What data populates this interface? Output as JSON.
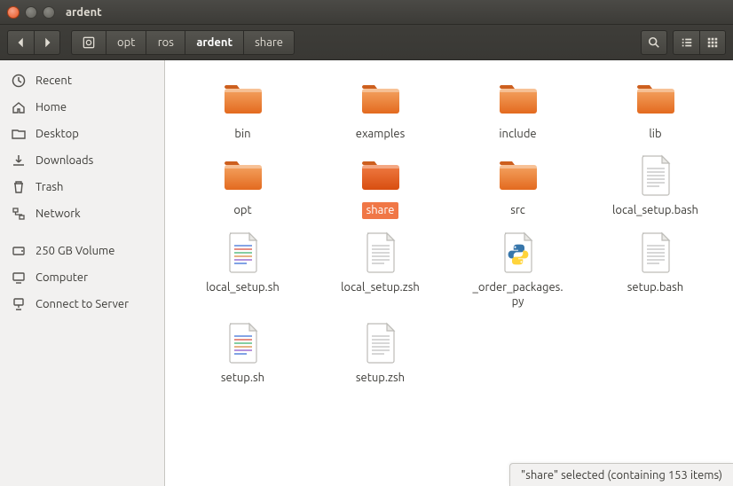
{
  "window": {
    "title": "ardent"
  },
  "toolbar": {
    "breadcrumb": [
      {
        "label": "",
        "icon": "disk"
      },
      {
        "label": "opt"
      },
      {
        "label": "ros"
      },
      {
        "label": "ardent",
        "active": true
      },
      {
        "label": "share"
      }
    ]
  },
  "sidebar": {
    "places": [
      {
        "label": "Recent",
        "icon": "recent"
      },
      {
        "label": "Home",
        "icon": "home"
      },
      {
        "label": "Desktop",
        "icon": "desktop"
      },
      {
        "label": "Downloads",
        "icon": "downloads"
      },
      {
        "label": "Trash",
        "icon": "trash"
      },
      {
        "label": "Network",
        "icon": "network"
      }
    ],
    "devices": [
      {
        "label": "250 GB Volume",
        "icon": "drive"
      },
      {
        "label": "Computer",
        "icon": "computer"
      },
      {
        "label": "Connect to Server",
        "icon": "connect"
      }
    ]
  },
  "files": [
    {
      "name": "bin",
      "type": "folder"
    },
    {
      "name": "examples",
      "type": "folder"
    },
    {
      "name": "include",
      "type": "folder"
    },
    {
      "name": "lib",
      "type": "folder"
    },
    {
      "name": "opt",
      "type": "folder"
    },
    {
      "name": "share",
      "type": "folder",
      "selected": true
    },
    {
      "name": "src",
      "type": "folder"
    },
    {
      "name": "local_setup.bash",
      "type": "text"
    },
    {
      "name": "local_setup.sh",
      "type": "script"
    },
    {
      "name": "local_setup.zsh",
      "type": "text"
    },
    {
      "name": "_order_packages.\npy",
      "type": "python"
    },
    {
      "name": "setup.bash",
      "type": "text"
    },
    {
      "name": "setup.sh",
      "type": "script"
    },
    {
      "name": "setup.zsh",
      "type": "text"
    }
  ],
  "status": {
    "text": "\"share\" selected  (containing 153 items)"
  }
}
